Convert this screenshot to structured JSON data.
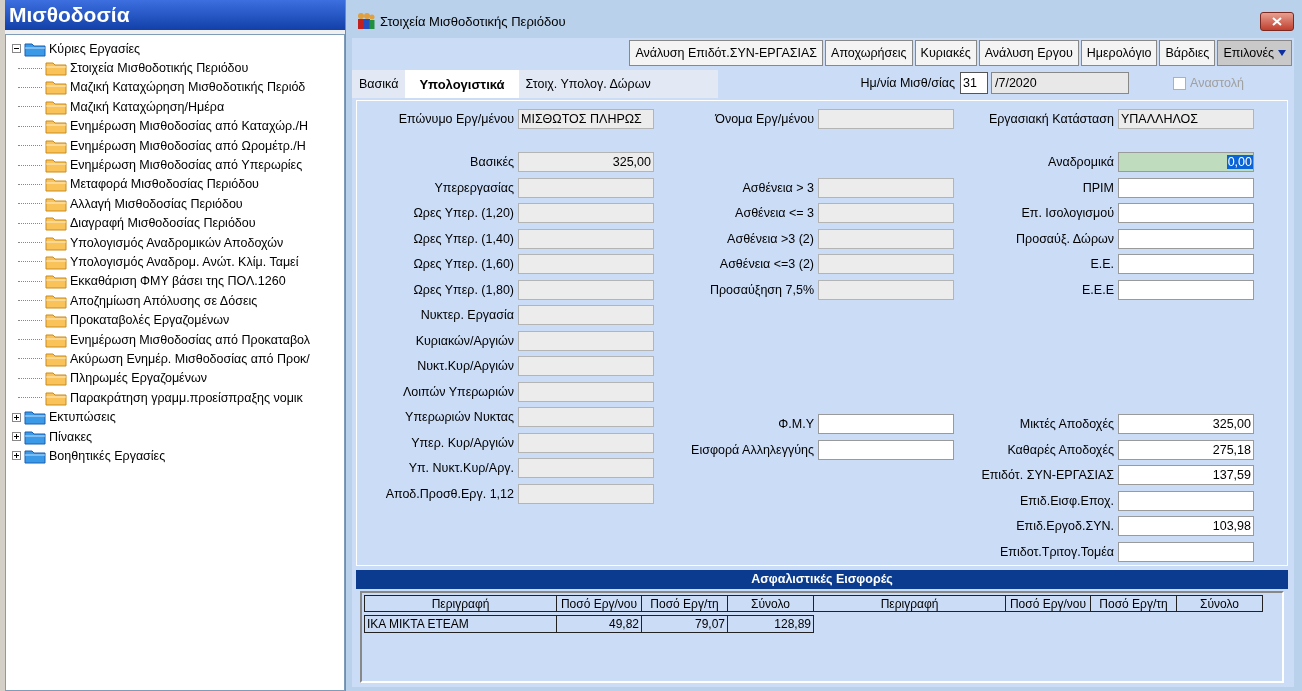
{
  "sidebar": {
    "title": "Μισθοδοσία",
    "tree": [
      {
        "label": "Κύριες Εργασίες",
        "expanded": true,
        "children": [
          {
            "label": "Στοιχεία Μισθοδοτικής Περιόδου"
          },
          {
            "label": "Μαζική Καταχώρηση Μισθοδοτικής Περιόδ"
          },
          {
            "label": "Μαζική Καταχώρηση/Ημέρα"
          },
          {
            "label": "Ενημέρωση Μισθοδοσίας από Καταχώρ./Η"
          },
          {
            "label": "Ενημέρωση Μισθοδοσίας από Ωρομέτρ./Η"
          },
          {
            "label": "Ενημέρωση Μισθοδοσίας από Υπερωρίες"
          },
          {
            "label": "Μεταφορά Μισθοδοσίας Περιόδου"
          },
          {
            "label": "Αλλαγή Μισθοδοσίας Περιόδου"
          },
          {
            "label": "Διαγραφή Μισθοδοσίας Περιόδου"
          },
          {
            "label": "Υπολογισμός Αναδρομικών Αποδοχών"
          },
          {
            "label": "Υπολογισμός Αναδρομ. Ανώτ. Κλίμ. Ταμεί"
          },
          {
            "label": "Εκκαθάριση ΦΜΥ βάσει της ΠΟΛ.1260"
          },
          {
            "label": "Αποζημίωση Απόλυσης σε Δόσεις"
          },
          {
            "label": "Προκαταβολές Εργαζομένων"
          },
          {
            "label": "Ενημέρωση Μισθοδοσίας από Προκαταβολ"
          },
          {
            "label": "Ακύρωση Ενημέρ. Μισθοδοσίας από Προκ/"
          },
          {
            "label": "Πληρωμές Εργαζομένων"
          },
          {
            "label": "Παρακράτηση γραμμ.προείσπραξης νομικ"
          }
        ]
      },
      {
        "label": "Εκτυπώσεις",
        "expanded": false
      },
      {
        "label": "Πίνακες",
        "expanded": false
      },
      {
        "label": "Βοηθητικές Εργασίες",
        "expanded": false
      }
    ]
  },
  "window": {
    "title": "Στοιχεία Μισθοδοτικής Περιόδου",
    "toolbar": [
      {
        "label": "Ανάλυση Επιδότ.ΣΥΝ-ΕΡΓΑΣΙΑΣ",
        "kind": "button"
      },
      {
        "label": "Αποχωρήσεις",
        "kind": "button"
      },
      {
        "label": "Κυριακές",
        "kind": "button"
      },
      {
        "label": "Ανάλυση Εργου",
        "kind": "button"
      },
      {
        "label": "Ημερολόγιο",
        "kind": "button"
      },
      {
        "label": "Βάρδιες",
        "kind": "button"
      },
      {
        "label": "Επιλονές",
        "kind": "menu"
      }
    ],
    "tabs": [
      {
        "label": "Βασικά",
        "selected": false
      },
      {
        "label": "Υπολογιστικά",
        "selected": true
      },
      {
        "label": "Στοιχ. Υπολογ. Δώρων",
        "selected": false
      }
    ],
    "date": {
      "label": "Ημ/νία Μισθ/σίας",
      "day": "31",
      "rest": "/7/2020"
    },
    "suspension": {
      "label": "Αναστολή",
      "checked": false,
      "disabled": true
    },
    "header_fields": [
      {
        "label": "Επώνυμο Εργ/μένου",
        "value": "ΜΙΣΘΩΤΟΣ ΠΛΗΡΩΣ",
        "editable": false
      },
      {
        "label": "Όνομα Εργ/μένου",
        "editable": false
      },
      {
        "label": "Εργασιακή Κατάσταση",
        "value": "ΥΠΑΛΛΗΛΟΣ",
        "editable": false
      }
    ],
    "columns": [
      {
        "groups": [
          [
            {
              "label": "Βασικές",
              "value": "325,00",
              "editable": false
            },
            {
              "label": "Υπερεργασίας",
              "editable": false
            },
            {
              "label": "Ωρες Υπερ. (1,20)",
              "editable": false
            },
            {
              "label": "Ωρες Υπερ. (1,40)",
              "editable": false
            },
            {
              "label": "Ωρες Υπερ. (1,60)",
              "editable": false
            },
            {
              "label": "Ωρες Υπερ. (1,80)",
              "editable": false
            },
            {
              "label": "Νυκτερ. Εργασία",
              "editable": false
            },
            {
              "label": "Κυριακών/Αργιών",
              "editable": false
            },
            {
              "label": "Νυκτ.Κυρ/Αργιών",
              "editable": false
            },
            {
              "label": "Λοιπών Υπερωριών",
              "editable": false
            },
            {
              "label": "Υπερωριών Νυκτας",
              "editable": false
            },
            {
              "label": "Υπερ. Κυρ/Αργιών",
              "editable": false
            },
            {
              "label": "Υπ. Νυκτ.Κυρ/Αργ.",
              "editable": false
            },
            {
              "label": "Αποδ.Προσθ.Εργ. 1,12",
              "editable": false
            }
          ]
        ]
      },
      {
        "groups": [
          [
            {
              "label": "Ασθένεια > 3",
              "editable": false
            },
            {
              "label": "Ασθένεια <= 3",
              "editable": false
            },
            {
              "label": "Ασθένεια >3 (2)",
              "editable": false
            },
            {
              "label": "Ασθένεια <=3 (2)",
              "editable": false
            },
            {
              "label": "Προσαύξηση 7,5%",
              "editable": false
            }
          ],
          [
            {
              "label": "Φ.Μ.Υ",
              "editable": true
            },
            {
              "label": "Εισφορά Αλληλεγγύης",
              "editable": true
            }
          ]
        ]
      },
      {
        "groups": [
          [
            {
              "label": "Αναδρομικά",
              "value": "0,00",
              "editable": true,
              "focused": true
            },
            {
              "label": "ΠΡΙΜ",
              "editable": true
            },
            {
              "label": "Επ. Ισολογισμού",
              "editable": true
            },
            {
              "label": "Προσαύξ. Δώρων",
              "editable": true
            },
            {
              "label": "Ε.Ε.",
              "editable": true
            },
            {
              "label": "Ε.Ε.Ε",
              "editable": true
            }
          ],
          [
            {
              "label": "Μικτές Αποδοχές",
              "value": "325,00",
              "editable": true
            },
            {
              "label": "Καθαρές Αποδοχές",
              "value": "275,18",
              "editable": true
            },
            {
              "label": "Επιδότ. ΣΥΝ-ΕΡΓΑΣΙΑΣ",
              "value": "137,59",
              "editable": true
            },
            {
              "label": "Επιδ.Εισφ.Εποχ.",
              "editable": true
            },
            {
              "label": "Επιδ.Εργοδ.ΣΥΝ.",
              "value": "103,98",
              "editable": true
            },
            {
              "label": "Επιδοτ.Τριτογ.Τομέα",
              "editable": true
            }
          ]
        ]
      }
    ],
    "contributions": {
      "title": "Ασφαλιστικές Εισφορές",
      "columns": [
        "Περιγραφή",
        "Ποσό Εργ/νου",
        "Ποσό Εργ/τη",
        "Σύνολο",
        "Περιγραφή",
        "Ποσό Εργ/νου",
        "Ποσό Εργ/τη",
        "Σύνολο"
      ],
      "rows": [
        [
          "ΙΚΑ ΜΙΚΤΑ ΕΤΕΑΜ",
          "49,82",
          "79,07",
          "128,89"
        ]
      ]
    }
  }
}
